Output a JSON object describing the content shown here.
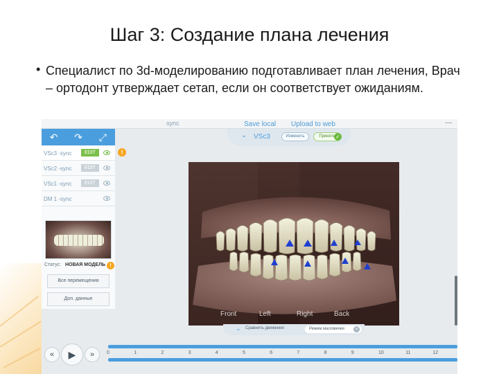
{
  "slide": {
    "title": "Шаг 3: Создание плана лечения",
    "bullet": "•",
    "body": "Специалист по 3d-моделированию подготавливает план лечения, Врач – ортодонт утверждает сетап, если он соответствует ожиданиям."
  },
  "app": {
    "topbar": {
      "sync_text": "sync",
      "save_local": "Save local",
      "upload_web": "Upload to web",
      "window_control": "—"
    },
    "toolbar": {
      "undo_icon": "↶",
      "redo_icon": "↷",
      "expand_icon": "⤢"
    },
    "versions": [
      {
        "name": "VSc3 -sync",
        "edit": "EDIT",
        "active": true
      },
      {
        "name": "VSc2 -sync",
        "edit": "EDIT",
        "active": false
      },
      {
        "name": "VSc1 -sync",
        "edit": "EDIT",
        "active": false
      },
      {
        "name": "DM 1 -sync",
        "edit": "",
        "active": false
      }
    ],
    "warn_symbol": "!",
    "status": {
      "label": "Статус:",
      "value": "НОВАЯ МОДЕЛЬ"
    },
    "buttons": {
      "all_moves": "Все перемещения",
      "extra_data": "Доп. данные"
    },
    "version_tab": {
      "chevron": "⌄",
      "label": "VSc3",
      "change": "Изменить",
      "accept": "Принять",
      "check": "✓"
    },
    "views": {
      "front": "Front",
      "left": "Left",
      "right": "Right",
      "back": "Back"
    },
    "bottom_tab": {
      "chevron": "⌄",
      "compare": "Сравнить движения",
      "mode": "Режим маломечки",
      "close": "×"
    },
    "player": {
      "rewind": "«",
      "play": "▶",
      "forward": "»",
      "ticks": [
        "0",
        "1",
        "2",
        "3",
        "4",
        "5",
        "6",
        "7",
        "8",
        "9",
        "10",
        "11",
        "12"
      ]
    }
  }
}
